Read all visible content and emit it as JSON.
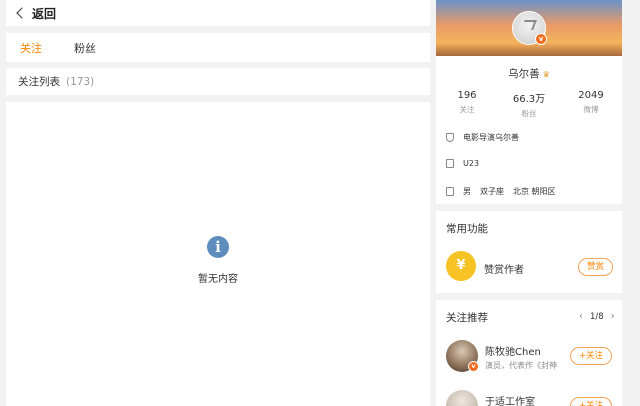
{
  "header": {
    "back_label": "返回"
  },
  "tabs": [
    {
      "label": "关注",
      "active": true
    },
    {
      "label": "粉丝",
      "active": false
    }
  ],
  "list": {
    "title": "关注列表",
    "count": "(173)"
  },
  "empty": {
    "icon": "info-icon",
    "text": "暂无内容"
  },
  "profile": {
    "name": "乌尔善",
    "verified_icon": "v-badge-icon",
    "stats": [
      {
        "value": "196",
        "label": "关注"
      },
      {
        "value": "66.3万",
        "label": "粉丝"
      },
      {
        "value": "2049",
        "label": "微博"
      }
    ],
    "verification": "电影导演乌尔善",
    "u_level": "U23",
    "gender": "男",
    "zodiac": "双子座",
    "location": "北京 朝阳区"
  },
  "functions": {
    "title": "常用功能",
    "reward_label": "赞赏作者",
    "reward_button": "赞赏"
  },
  "recommendations": {
    "title": "关注推荐",
    "pager": "1/8",
    "items": [
      {
        "name": "陈牧驰Chen",
        "desc": "演员，代表作《封神",
        "button": "+关注"
      },
      {
        "name": "于适工作室",
        "desc": "",
        "button": "+关注"
      }
    ]
  },
  "colors": {
    "accent": "#ff8200",
    "vip_badge": "#f06b1e",
    "info_icon": "#5e8cbd",
    "reward_gold": "#f7c223"
  }
}
